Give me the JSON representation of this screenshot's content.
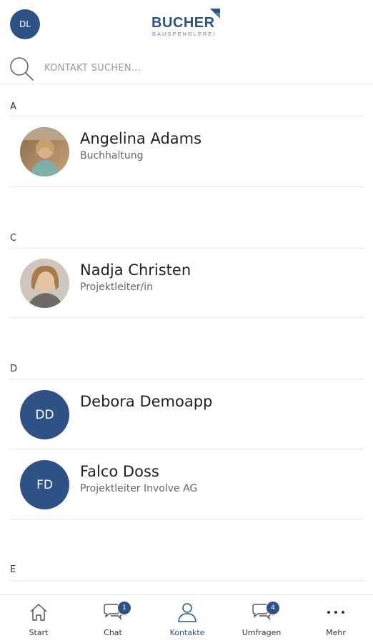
{
  "header": {
    "user_initials": "DL",
    "logo_brand": "BUCHER",
    "logo_sub": "BAUSPENGLEREI"
  },
  "search": {
    "placeholder": "KONTAKT SUCHEN..."
  },
  "sections": [
    {
      "letter": "A",
      "contacts": [
        {
          "name": "Angelina Adams",
          "role": "Buchhaltung",
          "avatar": "photo"
        }
      ]
    },
    {
      "letter": "C",
      "contacts": [
        {
          "name": "Nadja Christen",
          "role": "Projektleiter/in",
          "avatar": "photo"
        }
      ]
    },
    {
      "letter": "D",
      "contacts": [
        {
          "name": "Debora Demoapp",
          "role": "",
          "avatar": "initials",
          "initials": "DD"
        },
        {
          "name": "Falco Doss",
          "role": "Projektleiter Involve AG",
          "avatar": "initials",
          "initials": "FD"
        }
      ]
    },
    {
      "letter": "E",
      "contacts": []
    }
  ],
  "tabbar": {
    "tabs": [
      {
        "label": "Start",
        "icon": "home-icon"
      },
      {
        "label": "Chat",
        "icon": "chat-icon",
        "badge": "1"
      },
      {
        "label": "Kontakte",
        "icon": "contacts-icon",
        "active": true
      },
      {
        "label": "Umfragen",
        "icon": "survey-icon",
        "badge": "4"
      },
      {
        "label": "Mehr",
        "icon": "more-icon"
      }
    ]
  },
  "colors": {
    "brand": "#2f5286",
    "divider": "#e6e6e6",
    "text": "#1f1f1f",
    "muted": "#666666"
  }
}
